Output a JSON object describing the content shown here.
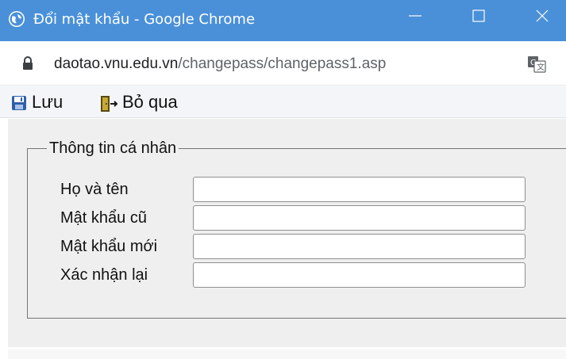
{
  "window": {
    "title": "Đổi mật khẩu - Google Chrome",
    "accent_color": "#4a90d9",
    "controls": {
      "minimize_icon": "minimize-icon",
      "maximize_icon": "maximize-icon",
      "close_icon": "close-icon"
    }
  },
  "address_bar": {
    "domain": "daotao.vnu.edu.vn",
    "path": "/changepass/changepass1.asp",
    "lock_icon": "lock-icon",
    "translate_icon": "translate-icon"
  },
  "toolbar": {
    "save_label": "Lưu",
    "save_icon": "floppy-disk-icon",
    "skip_label": "Bỏ qua",
    "skip_icon": "exit-door-icon"
  },
  "form": {
    "legend": "Thông tin cá nhân",
    "fields": [
      {
        "label": "Họ và tên",
        "value": "",
        "placeholder": ""
      },
      {
        "label": "Mật khẩu cũ",
        "value": "",
        "placeholder": ""
      },
      {
        "label": "Mật khẩu mới",
        "value": "",
        "placeholder": ""
      },
      {
        "label": "Xác nhận lại",
        "value": "",
        "placeholder": ""
      }
    ]
  }
}
